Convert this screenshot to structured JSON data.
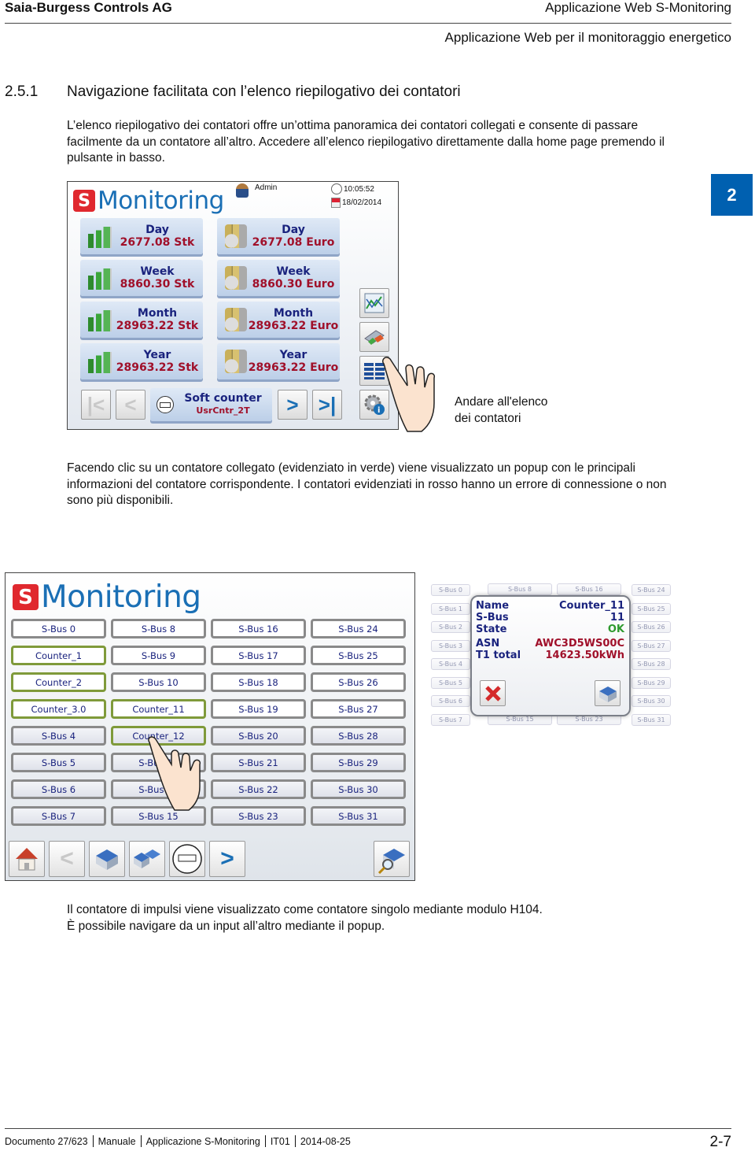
{
  "header": {
    "company": "Saia-Burgess Controls AG",
    "product": "Applicazione Web S-Monitoring",
    "subtitle": "Applicazione Web per il monitoraggio energetico"
  },
  "section": {
    "number": "2.5.1",
    "title": "Navigazione facilitata con l’elenco riepilogativo dei contatori"
  },
  "chapter_tab": "2",
  "paragraphs": {
    "intro": "L’elenco riepilogativo dei contatori offre un’ottima panoramica dei contatori collegati e consente di passare facilmente da un contatore all’altro. Accedere all’elenco riepilogativo direttamente dalla home page premendo il pulsante in basso.",
    "popup_info": "Facendo clic su un contatore collegato (evidenziato in verde) viene visualizzato un popup con le principali informazioni del contatore corrispondente. I contatori evidenziati in rosso hanno un errore di connessione o non sono più disponibili.",
    "pulse_line1": "Il contatore di impulsi viene visualizzato come contatore singolo mediante modulo H104.",
    "pulse_line2": "È possibile navigare da un input all’altro mediante il popup."
  },
  "callout": {
    "line1": "Andare all'elenco",
    "line2": "dei contatori"
  },
  "home_screen": {
    "logo_letter": "S",
    "logo_text": "Monitoring",
    "user": "Admin",
    "time": "10:05:52",
    "date": "18/02/2014",
    "tiles": [
      {
        "label": "Day",
        "value": "2677.08 Stk",
        "icon": "bar-chart-icon"
      },
      {
        "label": "Day",
        "value": "2677.08 Euro",
        "icon": "coins-icon"
      },
      {
        "label": "Week",
        "value": "8860.30 Stk",
        "icon": "bar-chart-icon"
      },
      {
        "label": "Week",
        "value": "8860.30 Euro",
        "icon": "coins-icon"
      },
      {
        "label": "Month",
        "value": "28963.22 Stk",
        "icon": "bar-chart-icon"
      },
      {
        "label": "Month",
        "value": "28963.22 Euro",
        "icon": "coins-icon"
      },
      {
        "label": "Year",
        "value": "28963.22 Stk",
        "icon": "bar-chart-icon"
      },
      {
        "label": "Year",
        "value": "28963.22 Euro",
        "icon": "coins-icon"
      }
    ],
    "side_buttons": [
      "trend-chart-icon",
      "export-icon",
      "counter-list-icon",
      "settings-info-icon"
    ],
    "soft_counter": {
      "label": "Soft counter",
      "value": "UsrCntr_2T"
    },
    "nav": {
      "first": "first-icon",
      "prev": "previous-icon",
      "next": "next-icon",
      "last": "last-icon"
    }
  },
  "counter_list_screen": {
    "logo_letter": "S",
    "logo_text": "Monitoring",
    "columns": [
      [
        "S-Bus 0",
        "Counter_1",
        "Counter_2",
        "Counter_3.0",
        "S-Bus 4",
        "S-Bus 5",
        "S-Bus 6",
        "S-Bus 7"
      ],
      [
        "S-Bus 8",
        "S-Bus 9",
        "S-Bus 10",
        "Counter_11",
        "Counter_12",
        "S-Bus 13",
        "S-Bus 14",
        "S-Bus 15"
      ],
      [
        "S-Bus 16",
        "S-Bus 17",
        "S-Bus 18",
        "S-Bus 19",
        "S-Bus 20",
        "S-Bus 21",
        "S-Bus 22",
        "S-Bus 23"
      ],
      [
        "S-Bus 24",
        "S-Bus 25",
        "S-Bus 26",
        "S-Bus 27",
        "S-Bus 28",
        "S-Bus 29",
        "S-Bus 30",
        "S-Bus 31"
      ]
    ],
    "connected": [
      "Counter_1",
      "Counter_2",
      "Counter_3.0",
      "Counter_11",
      "Counter_12"
    ],
    "toolbar": [
      "home-icon",
      "previous-icon",
      "device-icon",
      "devices-icon",
      "meter-icon",
      "next-icon"
    ],
    "toolbar_right": "device-search-icon"
  },
  "popup": {
    "ghost_left": [
      "S-Bus 0",
      "S-Bus 1",
      "S-Bus 2",
      "S-Bus 3",
      "S-Bus 4",
      "S-Bus 5",
      "S-Bus 6",
      "S-Bus 7"
    ],
    "ghost_top": [
      "S-Bus 8",
      "S-Bus 16"
    ],
    "ghost_bottom": [
      "S-Bus 15",
      "S-Bus 23"
    ],
    "ghost_right": [
      "S-Bus 24",
      "S-Bus 25",
      "S-Bus 26",
      "S-Bus 27",
      "S-Bus 28",
      "S-Bus 29",
      "S-Bus 30",
      "S-Bus 31"
    ],
    "fields": [
      {
        "key": "Name",
        "value": "Counter_11",
        "status": "normal"
      },
      {
        "key": "S-Bus",
        "value": "11",
        "status": "normal"
      },
      {
        "key": "State",
        "value": "OK",
        "status": "ok"
      },
      {
        "key": "ASN",
        "value": "AWC3D5WS00C",
        "status": "red"
      },
      {
        "key": "T1 total",
        "value": "14623.50kWh",
        "status": "red"
      }
    ]
  },
  "colors": {
    "brand_blue": "#1a6fb5",
    "brand_red": "#e0282e",
    "chapter_tab": "#0060b0",
    "connected_border": "#7f9a3a",
    "value_red": "#a0102a",
    "label_navy": "#1a237e",
    "state_ok": "#2e9a2e"
  },
  "footer": {
    "items": [
      "Documento 27/623",
      "Manuale",
      "Applicazione S-Monitoring",
      "IT01",
      "2014-08-25"
    ],
    "page": "2-7"
  }
}
